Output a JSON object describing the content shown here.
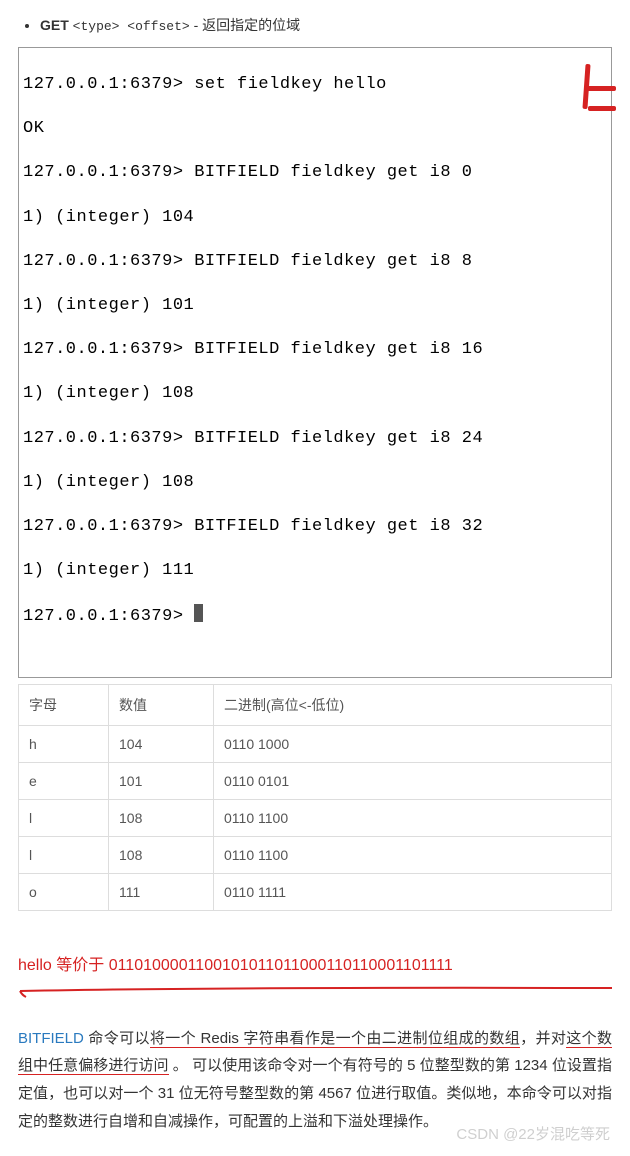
{
  "note": {
    "cmd": "GET",
    "args": "<type> <offset>",
    "desc": " - 返回指定的位域"
  },
  "code": {
    "lines": [
      "127.0.0.1:6379> set fieldkey hello",
      "OK",
      "127.0.0.1:6379> BITFIELD fieldkey get i8 0",
      "1) (integer) 104",
      "127.0.0.1:6379> BITFIELD fieldkey get i8 8",
      "1) (integer) 101",
      "127.0.0.1:6379> BITFIELD fieldkey get i8 16",
      "1) (integer) 108",
      "127.0.0.1:6379> BITFIELD fieldkey get i8 24",
      "1) (integer) 108",
      "127.0.0.1:6379> BITFIELD fieldkey get i8 32",
      "1) (integer) 111",
      "127.0.0.1:6379> "
    ]
  },
  "table": {
    "head": {
      "c1": "字母",
      "c2": "数值",
      "c3": "二进制(高位<-低位)"
    },
    "rows": [
      {
        "c1": "h",
        "c2": "104",
        "c3": "0110 1000"
      },
      {
        "c1": "e",
        "c2": "101",
        "c3": "0110 0101"
      },
      {
        "c1": "l",
        "c2": "108",
        "c3": "0110 1100"
      },
      {
        "c1": "l",
        "c2": "108",
        "c3": "0110 1100"
      },
      {
        "c1": "o",
        "c2": "111",
        "c3": "0110 1111"
      }
    ]
  },
  "equiv": "hello 等价于 0110100001100101011011000110110001101111",
  "para": {
    "link": "BITFIELD",
    "p1a": " 命令可以",
    "p1u1": "将一个 Redis 字符串看作是一个由二进制位组成的数组",
    "p1b": "，并对",
    "p1u2": "这个数组中任意偏移进行访问",
    "p1c": " 。 可以使用该命令对一个有符号的 5 位整型数的第 1234 位设置指定值，也可以对一个 31 位无符号整型数的第 4567 位进行取值。类似地，本命令可以对指定的整数进行自增和自减操作，可配置的上溢和下溢处理操作。"
  },
  "watermark": "CSDN @22岁混吃等死"
}
